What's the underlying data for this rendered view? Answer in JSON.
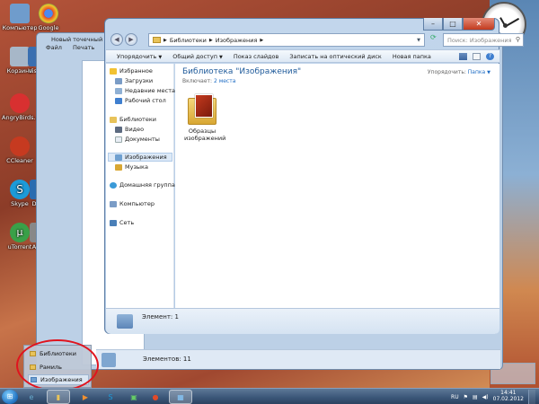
{
  "desktop": {
    "icons": [
      {
        "label": "Компьютер",
        "color": "#6f9ccc"
      },
      {
        "label": "Google",
        "color": "#e04a2a"
      },
      {
        "label": "Корзина",
        "color": "#a7b7c8"
      },
      {
        "label": "Visi",
        "color": "#3a6fb0"
      },
      {
        "label": "AngryBirds...",
        "color": "#d83030"
      },
      {
        "label": "CCleaner",
        "color": "#c63a20"
      },
      {
        "label": "Skype",
        "color": "#1c9ad8"
      },
      {
        "label": "D",
        "color": "#2a6cb0"
      },
      {
        "label": "uTorrent",
        "color": "#3aa048"
      },
      {
        "label": "A",
        "color": "#888888"
      }
    ]
  },
  "bg_window": {
    "title": "Новый точечный рису",
    "menu": [
      "Файл",
      "Печать"
    ],
    "status_text": "Элементов: 11"
  },
  "window": {
    "address": {
      "segments": [
        "Библиотеки",
        "Изображения"
      ],
      "separator": "▶"
    },
    "search_placeholder": "Поиск: Изображения",
    "toolbar": [
      "Упорядочить",
      "Общий доступ",
      "Показ слайдов",
      "Записать на оптический диск",
      "Новая папка"
    ],
    "nav": {
      "favorites_header": "Избранное",
      "favorites": [
        "Загрузки",
        "Недавние места",
        "Рабочий стол"
      ],
      "libraries_header": "Библиотеки",
      "libraries": [
        "Видео",
        "Документы",
        "Изображения",
        "Музыка"
      ],
      "homegroup": "Домашняя группа",
      "computer": "Компьютер",
      "network": "Сеть"
    },
    "content": {
      "title": "Библиотека \"Изображения\"",
      "includes_prefix": "Включает:",
      "includes_link": "2 места",
      "sort_prefix": "Упорядочить:",
      "sort_value": "Папка",
      "folder_label": "Образцы изображений"
    },
    "status_text": "Элемент: 1"
  },
  "popup": {
    "items": [
      "Библиотеки",
      "Рамиль",
      "Изображения"
    ]
  },
  "taskbar": {
    "language": "RU",
    "time": "14:41",
    "date": "07.02.2012"
  }
}
